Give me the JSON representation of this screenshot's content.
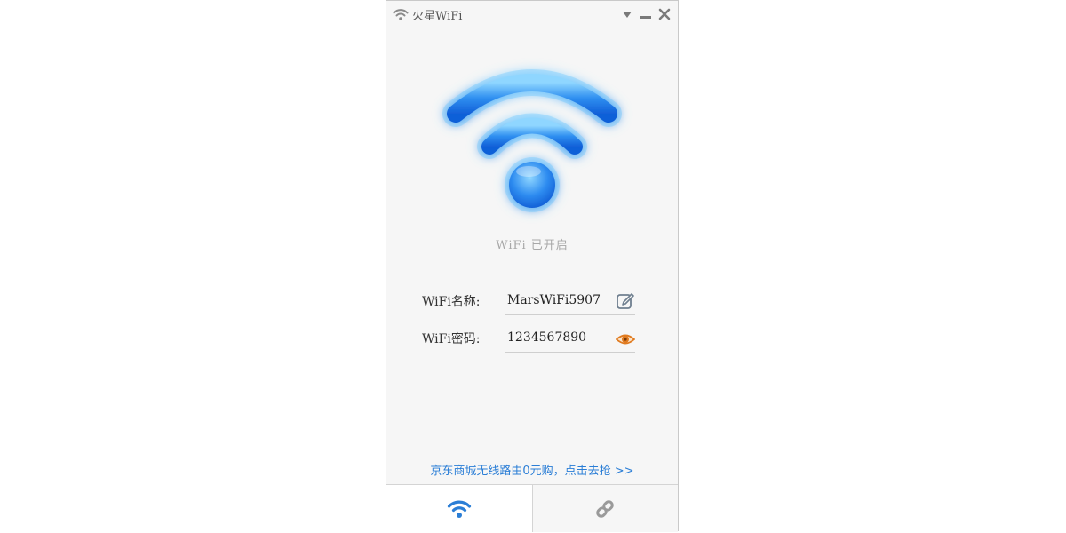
{
  "window": {
    "title": "火星WiFi",
    "controls": {
      "menu_icon": "dropdown-triangle-icon",
      "minimize_icon": "minimize-icon",
      "close_icon": "close-icon"
    }
  },
  "status": {
    "icon": "wifi-large-icon",
    "text": "WiFi 已开启"
  },
  "fields": {
    "name": {
      "label": "WiFi名称:",
      "value": "MarsWiFi5907",
      "action_icon": "edit-icon"
    },
    "password": {
      "label": "WiFi密码:",
      "value": "1234567890",
      "action_icon": "eye-icon"
    }
  },
  "promo": {
    "text": "京东商城无线路由0元购，点击去抢 >>"
  },
  "tabs": [
    {
      "icon": "wifi-icon",
      "active": true
    },
    {
      "icon": "link-icon",
      "active": false
    }
  ],
  "colors": {
    "accent": "#2b7ed6",
    "eye_icon": "#e07a1f",
    "window_bg": "#f6f6f6"
  }
}
